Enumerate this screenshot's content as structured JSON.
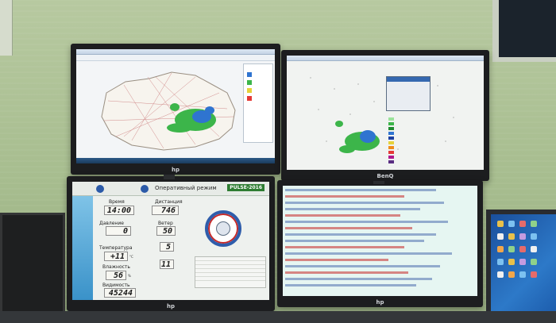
{
  "monitors": {
    "m1": {
      "brand": "hp"
    },
    "m2": {
      "brand": "BenQ"
    },
    "m3": {
      "brand": "hp",
      "app_title": "Оперативный режим",
      "logo": "PULSE-2016",
      "fields": {
        "time_label": "Время",
        "time_value": "14:00",
        "distance_label": "Дистанция",
        "distance_value": "746",
        "pressure_label": "Давление",
        "pressure_value": "0",
        "wind_label": "Ветер",
        "wind_value": "50",
        "temperature_label": "Температура",
        "temperature_value": "+11",
        "temperature_unit": "°С",
        "humidity_label": "Влажность",
        "humidity_value": "56",
        "humidity_unit": "%",
        "visibility_label": "Видимость",
        "visibility_value": "45244",
        "speed1_value": "5",
        "speed2_value": "11"
      }
    },
    "m4": {
      "brand": "hp"
    }
  },
  "colors": {
    "radar_green": "#3cb54a",
    "radar_blue": "#2f74d0",
    "log_red": "#c62828",
    "log_blue": "#2d4fa0"
  }
}
